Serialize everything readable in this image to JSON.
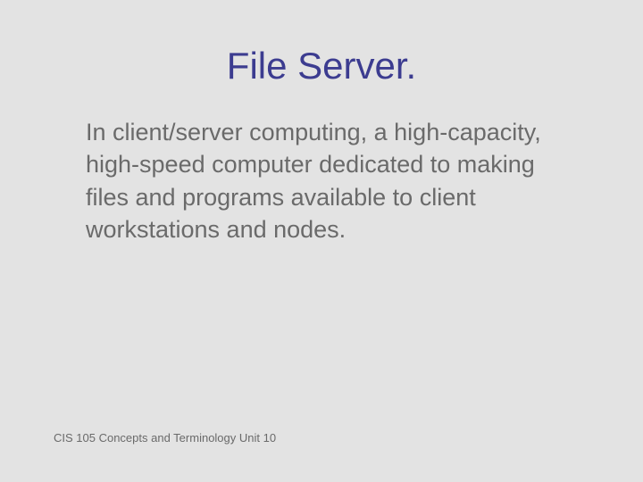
{
  "slide": {
    "title": "File Server.",
    "body": "In client/server computing, a high-capacity, high-speed computer dedicated  to making files and programs available to client workstations and nodes.",
    "footer": "CIS 105 Concepts and Terminology  Unit 10"
  }
}
